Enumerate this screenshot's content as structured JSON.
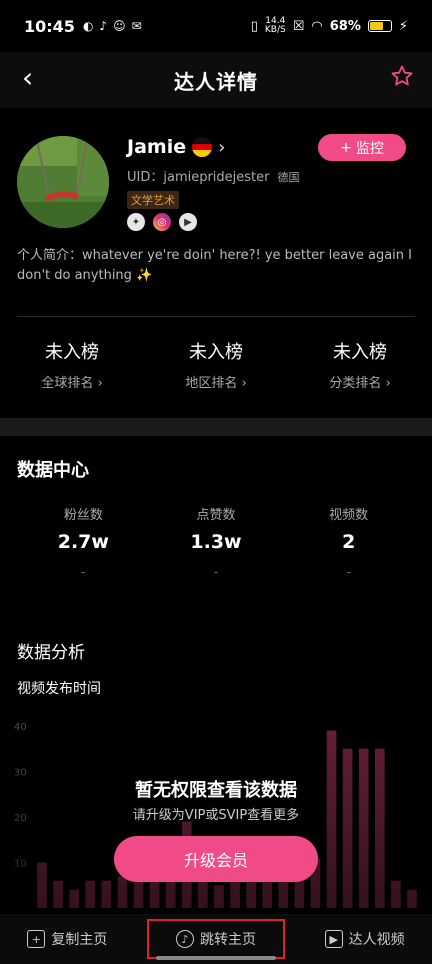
{
  "status_bar": {
    "time": "10:45",
    "net_speed_value": "14.4",
    "net_speed_unit": "KB/S",
    "battery": "68%",
    "battery_level": 0.68
  },
  "nav": {
    "title": "达人详情"
  },
  "profile": {
    "name": "Jamie",
    "uid": "UID：jamiepridejester",
    "country": "德国",
    "tag": "文学艺术",
    "monitor_label": "监控",
    "bio": "个人简介：whatever ye're doin' here?! ye better leave again I don't do anything ✨"
  },
  "ranks": [
    {
      "value": "未入榜",
      "label": "全球排名"
    },
    {
      "value": "未入榜",
      "label": "地区排名"
    },
    {
      "value": "未入榜",
      "label": "分类排名"
    }
  ],
  "data_center": {
    "title": "数据中心",
    "stats": [
      {
        "label": "粉丝数",
        "value": "2.7w",
        "delta": "-"
      },
      {
        "label": "点赞数",
        "value": "1.3w",
        "delta": "-"
      },
      {
        "label": "视频数",
        "value": "2",
        "delta": "-"
      }
    ]
  },
  "analysis": {
    "title": "数据分析",
    "subtitle": "视频发布时间"
  },
  "chart_data": {
    "type": "bar",
    "ylim": [
      0,
      40
    ],
    "yticks": [
      "40",
      "30",
      "20",
      "10"
    ],
    "values": [
      10,
      6,
      4,
      6,
      6,
      7,
      8,
      13,
      10,
      19,
      10,
      5,
      8,
      10,
      7,
      7,
      7,
      11,
      39,
      35,
      35,
      35,
      6,
      4
    ],
    "color": "#f04b86"
  },
  "lock": {
    "title": "暂无权限查看该数据",
    "subtitle": "请升级为VIP或SVIP查看更多",
    "button": "升级会员"
  },
  "bottom_bar": [
    {
      "label": "复制主页",
      "icon": "copy-icon"
    },
    {
      "label": "跳转主页",
      "icon": "tiktok-icon"
    },
    {
      "label": "达人视频",
      "icon": "video-icon"
    }
  ]
}
